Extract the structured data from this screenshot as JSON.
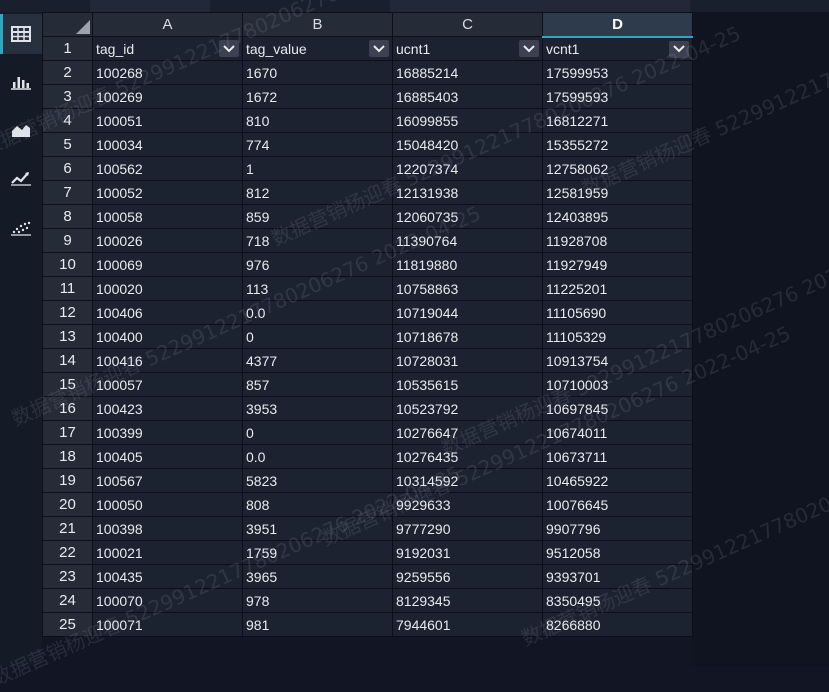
{
  "columns": [
    {
      "letter": "A",
      "header": "tag_id",
      "active": false
    },
    {
      "letter": "B",
      "header": "tag_value",
      "active": false
    },
    {
      "letter": "C",
      "header": "ucnt1",
      "active": false
    },
    {
      "letter": "D",
      "header": "vcnt1",
      "active": true
    }
  ],
  "rows": [
    {
      "num": "2",
      "cells": [
        "100268",
        "1670",
        "16885214",
        "17599953"
      ]
    },
    {
      "num": "3",
      "cells": [
        "100269",
        "1672",
        "16885403",
        "17599593"
      ]
    },
    {
      "num": "4",
      "cells": [
        "100051",
        "810",
        "16099855",
        "16812271"
      ]
    },
    {
      "num": "5",
      "cells": [
        "100034",
        "774",
        "15048420",
        "15355272"
      ]
    },
    {
      "num": "6",
      "cells": [
        "100562",
        "1",
        "12207374",
        "12758062"
      ]
    },
    {
      "num": "7",
      "cells": [
        "100052",
        "812",
        "12131938",
        "12581959"
      ]
    },
    {
      "num": "8",
      "cells": [
        "100058",
        "859",
        "12060735",
        "12403895"
      ]
    },
    {
      "num": "9",
      "cells": [
        "100026",
        "718",
        "11390764",
        "11928708"
      ]
    },
    {
      "num": "10",
      "cells": [
        "100069",
        "976",
        "11819880",
        "11927949"
      ]
    },
    {
      "num": "11",
      "cells": [
        "100020",
        "113",
        "10758863",
        "11225201"
      ]
    },
    {
      "num": "12",
      "cells": [
        "100406",
        "0.0",
        "10719044",
        "11105690"
      ]
    },
    {
      "num": "13",
      "cells": [
        "100400",
        "0",
        "10718678",
        "11105329"
      ]
    },
    {
      "num": "14",
      "cells": [
        "100416",
        "4377",
        "10728031",
        "10913754"
      ]
    },
    {
      "num": "15",
      "cells": [
        "100057",
        "857",
        "10535615",
        "10710003"
      ]
    },
    {
      "num": "16",
      "cells": [
        "100423",
        "3953",
        "10523792",
        "10697845"
      ]
    },
    {
      "num": "17",
      "cells": [
        "100399",
        "0",
        "10276647",
        "10674011"
      ]
    },
    {
      "num": "18",
      "cells": [
        "100405",
        "0.0",
        "10276435",
        "10673711"
      ]
    },
    {
      "num": "19",
      "cells": [
        "100567",
        "5823",
        "10314592",
        "10465922"
      ]
    },
    {
      "num": "20",
      "cells": [
        "100050",
        "808",
        "9929633",
        "10076645"
      ]
    },
    {
      "num": "21",
      "cells": [
        "100398",
        "3951",
        "9777290",
        "9907796"
      ]
    },
    {
      "num": "22",
      "cells": [
        "100021",
        "1759",
        "9192031",
        "9512058"
      ]
    },
    {
      "num": "23",
      "cells": [
        "100435",
        "3965",
        "9259556",
        "9393701"
      ]
    },
    {
      "num": "24",
      "cells": [
        "100070",
        "978",
        "8129345",
        "8350495"
      ]
    },
    {
      "num": "25",
      "cells": [
        "100071",
        "981",
        "7944601",
        "8266880"
      ]
    }
  ],
  "header_row_num": "1",
  "sidebar_icons": [
    "table-icon",
    "bar-chart-icon",
    "area-chart-icon",
    "line-chart-icon",
    "scatter-chart-icon"
  ],
  "watermark_text": "数据营销杨迎春 5229912217780206276 2022-04-25",
  "colors": {
    "accent": "#2ea7c4",
    "cell_bg": "#1d2230",
    "header_bg": "#262b38"
  }
}
